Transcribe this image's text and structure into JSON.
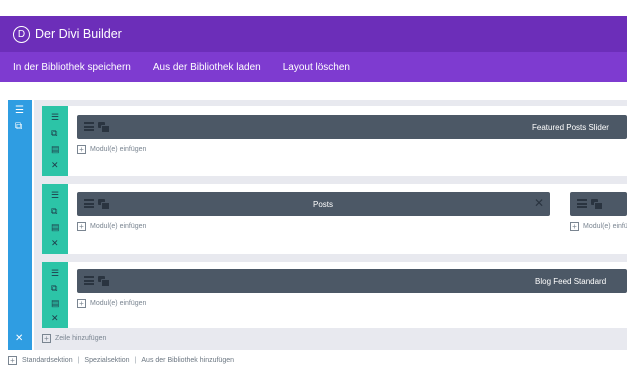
{
  "header": {
    "logo_letter": "D",
    "title": "Der Divi Builder"
  },
  "menu": {
    "save_library": "In der Bibliothek speichern",
    "load_library": "Aus der Bibliothek laden",
    "delete_layout": "Layout löschen"
  },
  "modules": {
    "featured_posts_slider": "Featured Posts Slider",
    "posts": "Posts",
    "blog_feed_standard": "Blog Feed Standard"
  },
  "add_module": "Modul(e) einfügen",
  "add_row": "Zeile hinzufügen",
  "footer": {
    "standard": "Standardsektion",
    "special": "Spezialsektion",
    "from_library": "Aus der Bibliothek hinzufügen",
    "separator": "|"
  },
  "colors": {
    "header": "#6c2eb9",
    "menubar": "#7e3bd0",
    "section": "#2f9de2",
    "row": "#2cc4a7",
    "module": "#4c5866"
  }
}
